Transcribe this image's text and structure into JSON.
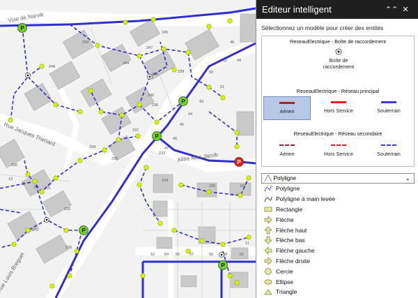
{
  "panel": {
    "title": "Editeur intelligent",
    "prompt": "Sélectionnez un modèle pour créer des entités",
    "groups": [
      {
        "title": "ReseauElectrique - Boîte de raccordement",
        "items": [
          {
            "label": "Boîte de raccordement"
          }
        ]
      },
      {
        "title": "ReseauElectrique - Réseau principal",
        "items": [
          {
            "label": "Aérien",
            "color": "#b01d1d",
            "selected": true
          },
          {
            "label": "Hors Service",
            "color": "#e3201b"
          },
          {
            "label": "Souterrain",
            "color": "#3b3bd6"
          }
        ]
      },
      {
        "title": "ReseauElectrique - Réseau secondaire",
        "items": [
          {
            "label": "Aérien",
            "color": "#b01d1d"
          },
          {
            "label": "Hors Service",
            "color": "#e3201b"
          },
          {
            "label": "Souterrain",
            "color": "#3b3bd6"
          }
        ]
      }
    ],
    "shape_select": {
      "value": "Polyligne"
    },
    "shapes": [
      "Polyligne",
      "Polyligne à main levée",
      "Rectangle",
      "Flèche",
      "Flèche haut",
      "Flèche bas",
      "Flèche gauche",
      "Flèche droite",
      "Cercle",
      "Ellipse",
      "Triangle"
    ]
  },
  "map": {
    "street_labels": [
      "Voie de Narvik",
      "Rue Jacques Thenard",
      "Allée Max Jacob",
      "Rue Louis Breguet"
    ],
    "parcel_numbers": [
      "243",
      "245",
      "248",
      "244",
      "242",
      "247",
      "239",
      "236",
      "238",
      "237",
      "234",
      "235",
      "233",
      "230",
      "231",
      "232",
      "229",
      "154",
      "156",
      "162",
      "226",
      "43",
      "44",
      "45",
      "46",
      "47",
      "48",
      "49",
      "50",
      "51",
      "52",
      "53",
      "54",
      "55",
      "57",
      "58",
      "59",
      "61",
      "11",
      "13",
      "15",
      "17"
    ],
    "colors": {
      "network": "#2f2fd0",
      "pole": "#d9f20a",
      "station": "#6fd21f",
      "station_out": "#e2231a"
    }
  }
}
